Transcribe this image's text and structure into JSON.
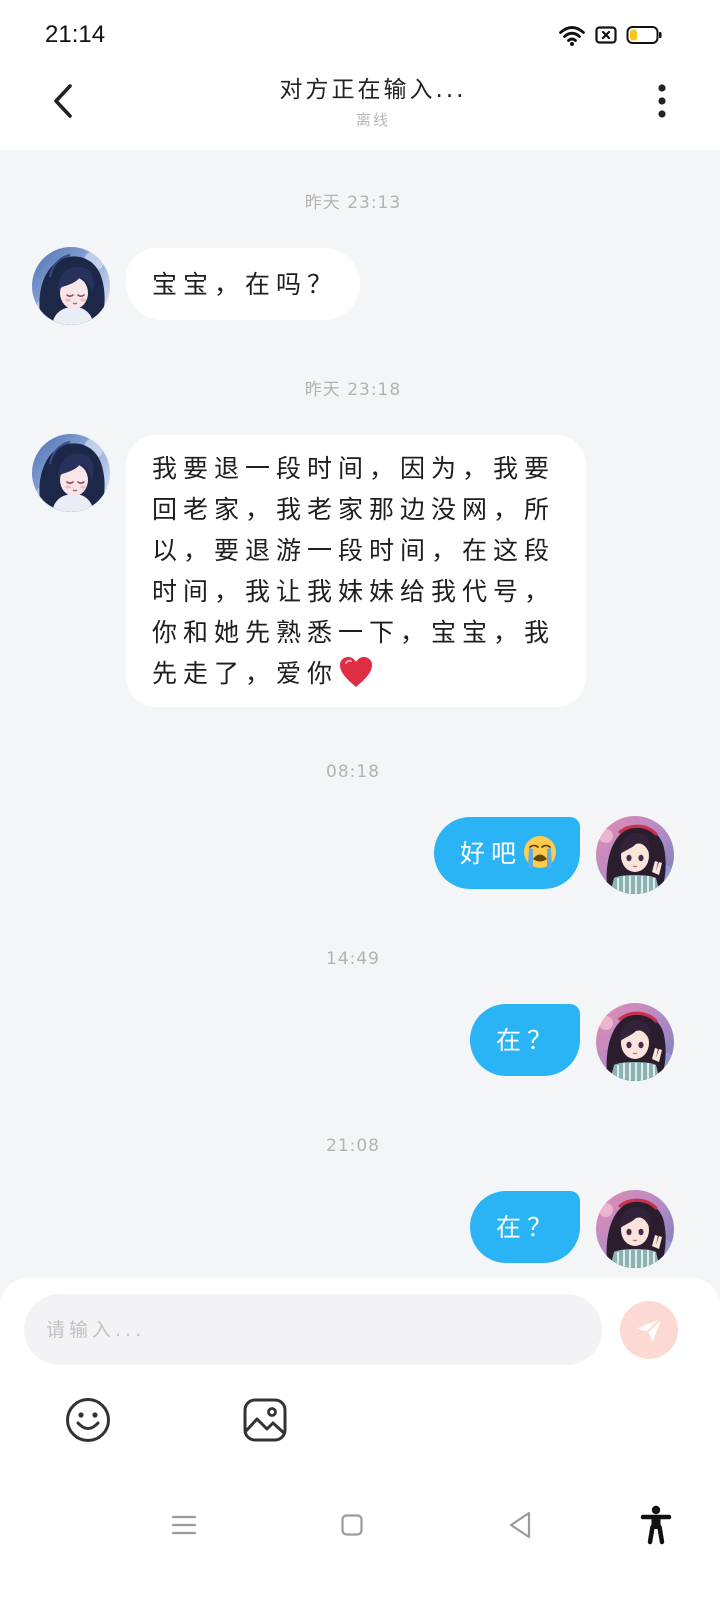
{
  "status_bar": {
    "time": "21:14",
    "icons": [
      "wifi-icon",
      "sim-card-off-icon",
      "battery-icon"
    ],
    "battery_level": 0.28
  },
  "header": {
    "back_icon": "back-chevron-icon",
    "title": "对方正在输入...",
    "subtitle": "离线",
    "more_icon": "more-vertical-icon"
  },
  "avatars": {
    "contact": "contact-avatar-image",
    "self": "self-avatar-image"
  },
  "messages": [
    {
      "kind": "timestamp",
      "text": "昨天 23:13"
    },
    {
      "kind": "received",
      "text": "宝宝，在吗？"
    },
    {
      "kind": "timestamp",
      "text": "昨天 23:18"
    },
    {
      "kind": "received",
      "text": "我要退一段时间，因为，我要回老家，我老家那边没网，所以，要退游一段时间，在这段时间，我让我妹妹给我代号，你和她先熟悉一下，宝宝，我先走了，爱你",
      "emoji_icon": "red-heart-emoji-icon"
    },
    {
      "kind": "timestamp",
      "text": "08:18"
    },
    {
      "kind": "sent",
      "text": "好吧",
      "emoji_icon": "loudly-crying-face-emoji-icon"
    },
    {
      "kind": "timestamp",
      "text": "14:49"
    },
    {
      "kind": "sent",
      "text": "在？"
    },
    {
      "kind": "timestamp",
      "text": "21:08"
    },
    {
      "kind": "sent",
      "text": "在？"
    }
  ],
  "composer": {
    "placeholder": "请输入...",
    "send_icon": "send-paper-plane-icon",
    "tools": [
      "emoji-icon",
      "image-icon"
    ]
  },
  "nav_bar": {
    "icons": [
      "menu-icon",
      "home-square-icon",
      "back-triangle-icon",
      "accessibility-icon"
    ]
  },
  "colors": {
    "chat_background": "#f4f5f7",
    "received_bubble": "#ffffff",
    "sent_bubble": "#2ab4f6",
    "send_button": "#fdd9d3",
    "timestamp_text": "#b3b3b3",
    "battery_fill": "#f5c518"
  }
}
